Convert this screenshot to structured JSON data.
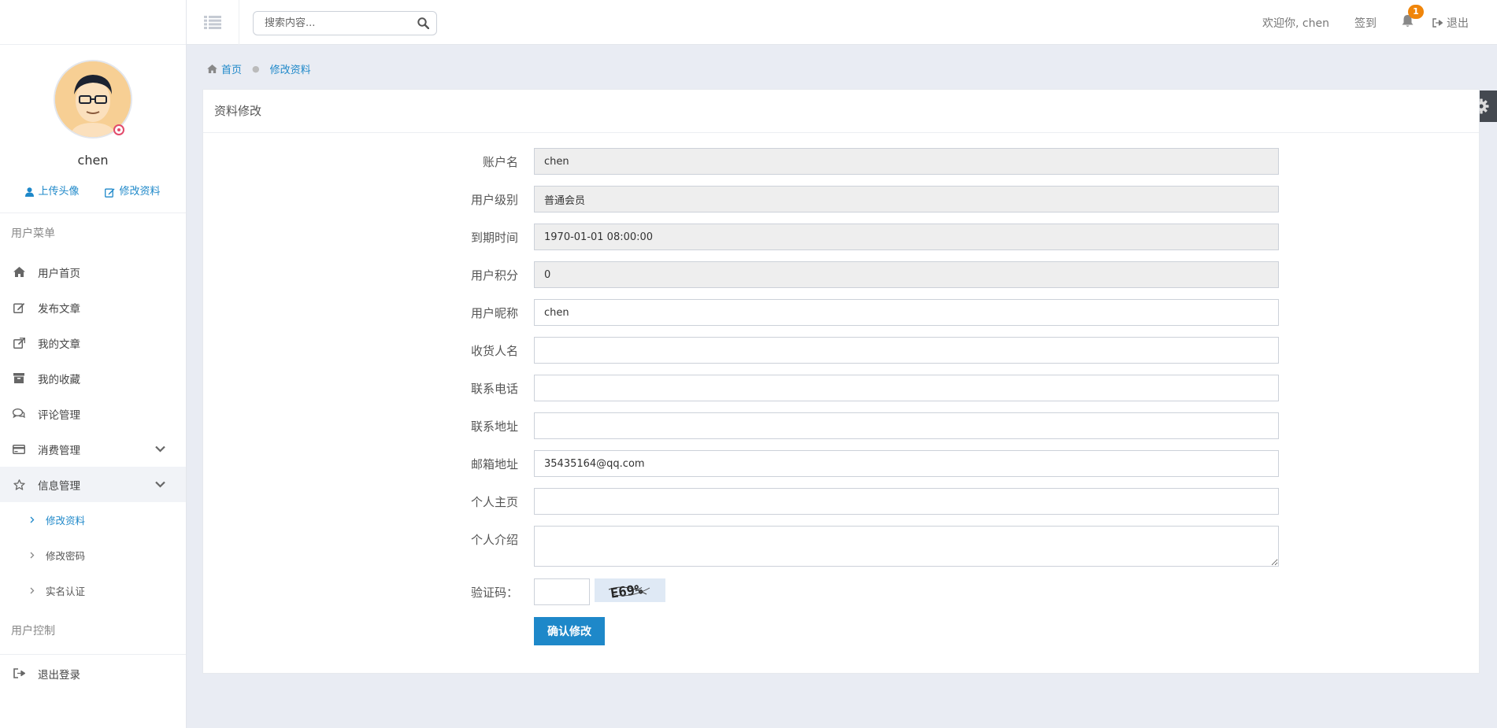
{
  "colors": {
    "accent": "#1e88c9",
    "badge": "#f0850a",
    "background": "#e9ecf3"
  },
  "profile": {
    "username": "chen",
    "upload_avatar": "上传头像",
    "edit_profile": "修改资料"
  },
  "sidebar": {
    "user_menu_header": "用户菜单",
    "items": [
      {
        "label": "用户首页",
        "icon": "home-icon"
      },
      {
        "label": "发布文章",
        "icon": "edit-icon"
      },
      {
        "label": "我的文章",
        "icon": "external-link-icon"
      },
      {
        "label": "我的收藏",
        "icon": "archive-icon"
      },
      {
        "label": "评论管理",
        "icon": "comments-icon"
      },
      {
        "label": "消费管理",
        "icon": "credit-card-icon"
      },
      {
        "label": "信息管理",
        "icon": "star-icon"
      }
    ],
    "sub_items": [
      {
        "label": "修改资料"
      },
      {
        "label": "修改密码"
      },
      {
        "label": "实名认证"
      }
    ],
    "user_control_header": "用户控制",
    "logout": "退出登录"
  },
  "topbar": {
    "search_placeholder": "搜索内容...",
    "welcome": "欢迎你, chen",
    "checkin": "签到",
    "notification_count": "1",
    "logout": "退出"
  },
  "breadcrumb": {
    "home": "首页",
    "current": "修改资料"
  },
  "panel": {
    "title": "资料修改"
  },
  "form": {
    "account_label": "账户名",
    "account_value": "chen",
    "level_label": "用户级别",
    "level_value": "普通会员",
    "expire_label": "到期时间",
    "expire_value": "1970-01-01 08:00:00",
    "points_label": "用户积分",
    "points_value": "0",
    "nickname_label": "用户昵称",
    "nickname_value": "chen",
    "receiver_label": "收货人名",
    "receiver_value": "",
    "phone_label": "联系电话",
    "phone_value": "",
    "address_label": "联系地址",
    "address_value": "",
    "email_label": "邮箱地址",
    "email_value": "35435164@qq.com",
    "homepage_label": "个人主页",
    "homepage_value": "",
    "intro_label": "个人介绍",
    "intro_value": "",
    "captcha_label": "验证码：",
    "captcha_value": "",
    "captcha_text": "E69%",
    "submit_label": "确认修改"
  }
}
